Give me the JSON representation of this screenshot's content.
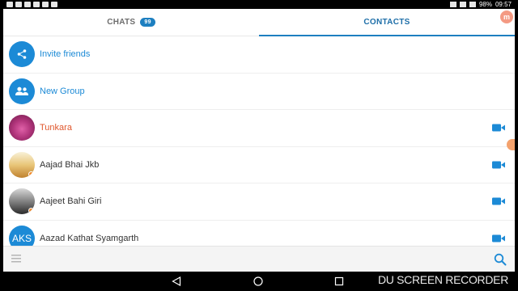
{
  "status_bar": {
    "battery": "98%",
    "time": "09:57"
  },
  "tabs": [
    {
      "label": "CHATS",
      "badge": "99",
      "active": false
    },
    {
      "label": "CONTACTS",
      "active": true
    }
  ],
  "corner_avatar_letter": "m",
  "actions": [
    {
      "label": "Invite friends",
      "icon": "share-icon"
    },
    {
      "label": "New Group",
      "icon": "group-icon"
    }
  ],
  "contacts": [
    {
      "name": "Tunkara",
      "avatar": "photo-pink",
      "highlight": true
    },
    {
      "name": "Aajad Bhai Jkb",
      "avatar": "photo-text"
    },
    {
      "name": "Aajeet Bahi Giri",
      "avatar": "photo-bw"
    },
    {
      "name": "Aazad Kathat Syamgarth",
      "avatar_initials": "AKS"
    }
  ],
  "colors": {
    "accent": "#1d7fc0",
    "highlight_name": "#e0572d",
    "video_icon": "#1c8ad6"
  },
  "watermark": "DU SCREEN RECORDER"
}
